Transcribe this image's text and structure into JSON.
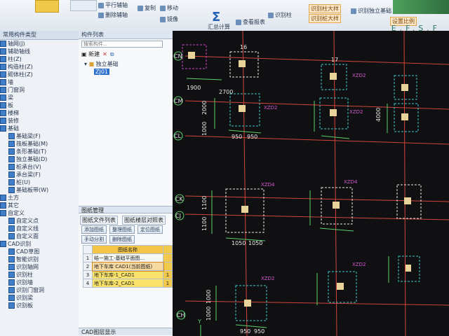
{
  "brand": "E.F.S.F",
  "ribbon": {
    "buttons": [
      "平行辅轴",
      "删除辅轴",
      "复制",
      "移动",
      "镜像",
      "汇总计算",
      "查看报表",
      "识别柱",
      "识别柱大样",
      "识别桩大样",
      "识别独立基础",
      "设置比例"
    ],
    "sigma": "Σ"
  },
  "left_tree": {
    "header": "常用构件类型",
    "items": [
      {
        "label": "轴网(J)",
        "sub": false
      },
      {
        "label": "辅助轴线",
        "sub": false
      },
      {
        "label": "柱(Z)",
        "sub": false
      },
      {
        "label": "构造柱(Z)",
        "sub": false
      },
      {
        "label": "砌体柱(Z)",
        "sub": false
      },
      {
        "label": "墙",
        "sub": false
      },
      {
        "label": "门窗洞",
        "sub": false
      },
      {
        "label": "梁",
        "sub": false
      },
      {
        "label": "板",
        "sub": false
      },
      {
        "label": "楼梯",
        "sub": false
      },
      {
        "label": "装修",
        "sub": false
      },
      {
        "label": "基础",
        "sub": false
      },
      {
        "label": "基础梁(F)",
        "sub": true
      },
      {
        "label": "筏板基础(M)",
        "sub": true
      },
      {
        "label": "条形基础(T)",
        "sub": true
      },
      {
        "label": "独立基础(D)",
        "sub": true
      },
      {
        "label": "桩承台(V)",
        "sub": true
      },
      {
        "label": "承台梁(F)",
        "sub": true
      },
      {
        "label": "桩(U)",
        "sub": true
      },
      {
        "label": "基础板带(W)",
        "sub": true
      },
      {
        "label": "土方",
        "sub": false
      },
      {
        "label": "其它",
        "sub": false
      },
      {
        "label": "自定义",
        "sub": false
      },
      {
        "label": "自定义点",
        "sub": true
      },
      {
        "label": "自定义线",
        "sub": true
      },
      {
        "label": "自定义面",
        "sub": true
      },
      {
        "label": "CAD识别",
        "sub": false
      },
      {
        "label": "CAD草图",
        "sub": true
      },
      {
        "label": "智能识别",
        "sub": true
      },
      {
        "label": "识别轴网",
        "sub": true
      },
      {
        "label": "识别柱",
        "sub": true
      },
      {
        "label": "识别墙",
        "sub": true
      },
      {
        "label": "识别门窗洞",
        "sub": true
      },
      {
        "label": "识别梁",
        "sub": true
      },
      {
        "label": "识别板",
        "sub": true
      }
    ]
  },
  "mid_panel": {
    "header": "构件列表",
    "search_placeholder": "搜索构件...",
    "new_label": "新建",
    "tree_root": "独立基础",
    "tree_child": "ZJ01",
    "drawing_mgmt_header": "图纸管理",
    "tabs": [
      "图纸文件列表",
      "图纸楼层对照表"
    ],
    "buttons_row1": [
      "添加图纸",
      "整理图纸",
      "定位图纸"
    ],
    "buttons_row2": [
      "手动分割",
      "删除图纸"
    ],
    "table_header": "图纸名称",
    "table_rows": [
      {
        "num": "1",
        "name": "结一施工-基础平面图...",
        "flag": "",
        "style": "plain"
      },
      {
        "num": "2",
        "name": "地下车库 CAD1(当前图纸)",
        "flag": "",
        "style": "highlight"
      },
      {
        "num": "3",
        "name": "地下车库-1_CAD1",
        "flag": "1",
        "style": "selected"
      },
      {
        "num": "4",
        "name": "地下车库-2_CAD1",
        "flag": "1",
        "style": "selected"
      }
    ],
    "bottom_header": "CAD图层显示"
  },
  "cad": {
    "axis_labels": [
      "CN",
      "CM",
      "CL",
      "CK",
      "CJ",
      "CH"
    ],
    "tags": [
      "XZD2",
      "XZD2",
      "XZD4",
      "XZD4",
      "XZD2",
      "XZD2",
      "XZD2"
    ],
    "dimensions": [
      "1900",
      "2700",
      "16",
      "17",
      "2000",
      "1000",
      "950",
      "950",
      "4000",
      "1100",
      "1100",
      "1050",
      "1050",
      "1000",
      "1000",
      "950",
      "950"
    ]
  }
}
